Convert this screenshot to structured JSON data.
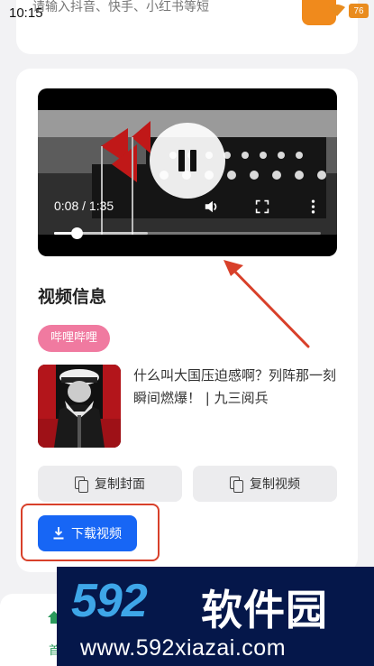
{
  "status_bar": {
    "time": "10:15",
    "battery": "76"
  },
  "url_input": {
    "placeholder": "请输入抖音、快手、小红书等短"
  },
  "player": {
    "time_display": "0:08 / 1:35",
    "progress_fraction": 0.085,
    "buffer_fraction": 0.35
  },
  "info": {
    "section_title": "视频信息",
    "platform_badge": "哔哩哔哩",
    "video_title": "什么叫大国压迫感啊？列阵那一刻瞬间燃爆！ | 九三阅兵"
  },
  "actions": {
    "copy_cover_label": "复制封面",
    "copy_video_label": "复制视频",
    "download_label": "下载视频"
  },
  "bottom_nav": {
    "home_label": "首"
  },
  "watermark": {
    "logo": "592",
    "brand": "软件园",
    "url": "www.592xiazai.com"
  },
  "colors": {
    "download_button": "#1766f5",
    "badge": "#f07aa0",
    "annotation": "#d8402a",
    "accent_orange": "#f08a1c"
  },
  "icons": [
    "pause-icon",
    "volume-icon",
    "fullscreen-icon",
    "more-vert-icon",
    "copy-icon",
    "download-icon",
    "wifi-icon",
    "battery-icon",
    "home-icon"
  ]
}
